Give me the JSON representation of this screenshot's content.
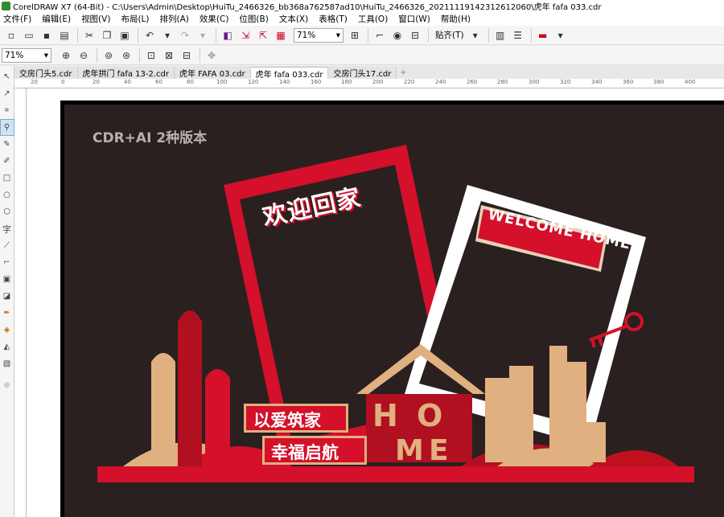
{
  "window": {
    "title": "CorelDRAW X7 (64-Bit) - C:\\Users\\Admin\\Desktop\\HuiTu_2466326_bb368a762587ad10\\HuiTu_2466326_20211119142312612060\\虎年 fafa 033.cdr"
  },
  "menu": [
    "文件(F)",
    "编辑(E)",
    "视图(V)",
    "布局(L)",
    "排列(A)",
    "效果(C)",
    "位图(B)",
    "文本(X)",
    "表格(T)",
    "工具(O)",
    "窗口(W)",
    "帮助(H)"
  ],
  "toolbar": {
    "zoom_value": "71%",
    "snap_label": "贴齐(T)"
  },
  "propbar": {
    "zoom_value": "71%"
  },
  "tabs": [
    {
      "label": "交房门头5.cdr",
      "active": false
    },
    {
      "label": "虎年拱门 fafa 13-2.cdr",
      "active": false
    },
    {
      "label": "虎年 FAFA 03.cdr",
      "active": false
    },
    {
      "label": "虎年 fafa 033.cdr",
      "active": true
    },
    {
      "label": "交房门头17.cdr",
      "active": false
    }
  ],
  "ruler": {
    "h_labels": [
      "20",
      "0",
      "20",
      "40",
      "60",
      "80",
      "100",
      "120",
      "140",
      "160",
      "180",
      "200",
      "220",
      "240",
      "260",
      "280",
      "300",
      "320",
      "340",
      "360",
      "380",
      "400"
    ]
  },
  "artwork": {
    "version_text": "CDR+AI 2种版本",
    "welcome_cn": "欢迎回家",
    "welcome_en": "WELCOME HOME",
    "slogan1": "以爱筑家",
    "slogan2": "幸福启航",
    "home_letters": [
      "H",
      "O",
      "M",
      "E"
    ],
    "colors": {
      "background": "#2a2020",
      "red": "#d4102a",
      "gold": "#e0b080",
      "white": "#ffffff"
    }
  }
}
